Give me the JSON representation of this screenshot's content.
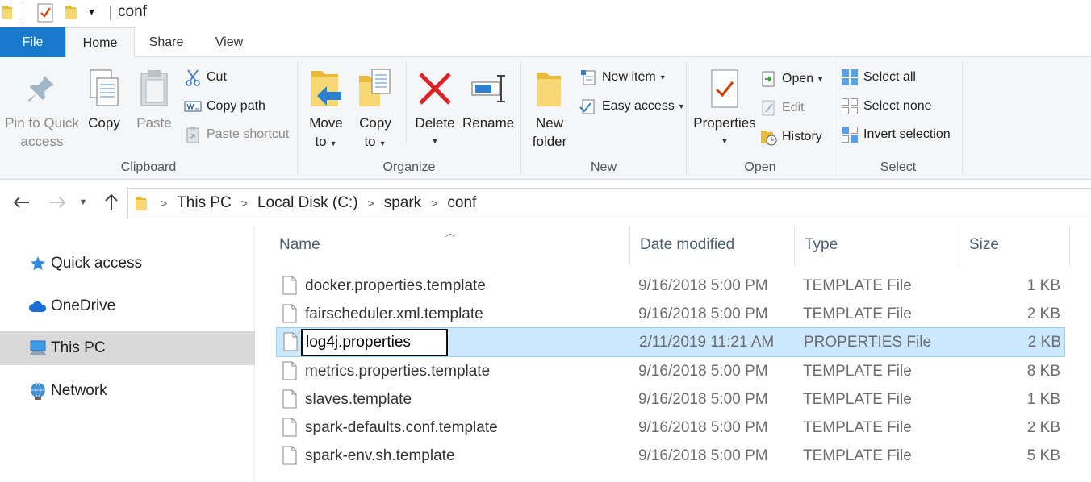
{
  "window": {
    "title": "conf"
  },
  "tabs": {
    "file": "File",
    "home": "Home",
    "share": "Share",
    "view": "View"
  },
  "ribbon": {
    "clipboard": {
      "label": "Clipboard",
      "pin_line1": "Pin to Quick",
      "pin_line2": "access",
      "copy": "Copy",
      "paste": "Paste",
      "cut": "Cut",
      "copy_path": "Copy path",
      "paste_shortcut": "Paste shortcut"
    },
    "organize": {
      "label": "Organize",
      "move_line1": "Move",
      "move_line2": "to",
      "copy_line1": "Copy",
      "copy_line2": "to",
      "delete": "Delete",
      "rename": "Rename"
    },
    "new": {
      "label": "New",
      "folder_line1": "New",
      "folder_line2": "folder",
      "new_item": "New item",
      "easy_access": "Easy access"
    },
    "open": {
      "label": "Open",
      "properties": "Properties",
      "open": "Open",
      "edit": "Edit",
      "history": "History"
    },
    "select": {
      "label": "Select",
      "select_all": "Select all",
      "select_none": "Select none",
      "invert": "Invert selection"
    }
  },
  "address": {
    "crumbs": [
      "This PC",
      "Local Disk (C:)",
      "spark",
      "conf"
    ]
  },
  "nav": {
    "quick_access": "Quick access",
    "onedrive": "OneDrive",
    "this_pc": "This PC",
    "network": "Network"
  },
  "columns": {
    "name": "Name",
    "date": "Date modified",
    "type": "Type",
    "size": "Size"
  },
  "files": [
    {
      "name": "docker.properties.template",
      "date": "9/16/2018 5:00 PM",
      "type": "TEMPLATE File",
      "size": "1 KB"
    },
    {
      "name": "fairscheduler.xml.template",
      "date": "9/16/2018 5:00 PM",
      "type": "TEMPLATE File",
      "size": "2 KB"
    },
    {
      "name": "log4j.properties",
      "date": "2/11/2019 11:21 AM",
      "type": "PROPERTIES File",
      "size": "2 KB"
    },
    {
      "name": "metrics.properties.template",
      "date": "9/16/2018 5:00 PM",
      "type": "TEMPLATE File",
      "size": "8 KB"
    },
    {
      "name": "slaves.template",
      "date": "9/16/2018 5:00 PM",
      "type": "TEMPLATE File",
      "size": "1 KB"
    },
    {
      "name": "spark-defaults.conf.template",
      "date": "9/16/2018 5:00 PM",
      "type": "TEMPLATE File",
      "size": "2 KB"
    },
    {
      "name": "spark-env.sh.template",
      "date": "9/16/2018 5:00 PM",
      "type": "TEMPLATE File",
      "size": "5 KB"
    }
  ],
  "colors": {
    "file_tab": "#1979ca",
    "selection": "#cce8ff",
    "selection_border": "#99d1ff",
    "nav_selected": "#d9d9d9"
  }
}
